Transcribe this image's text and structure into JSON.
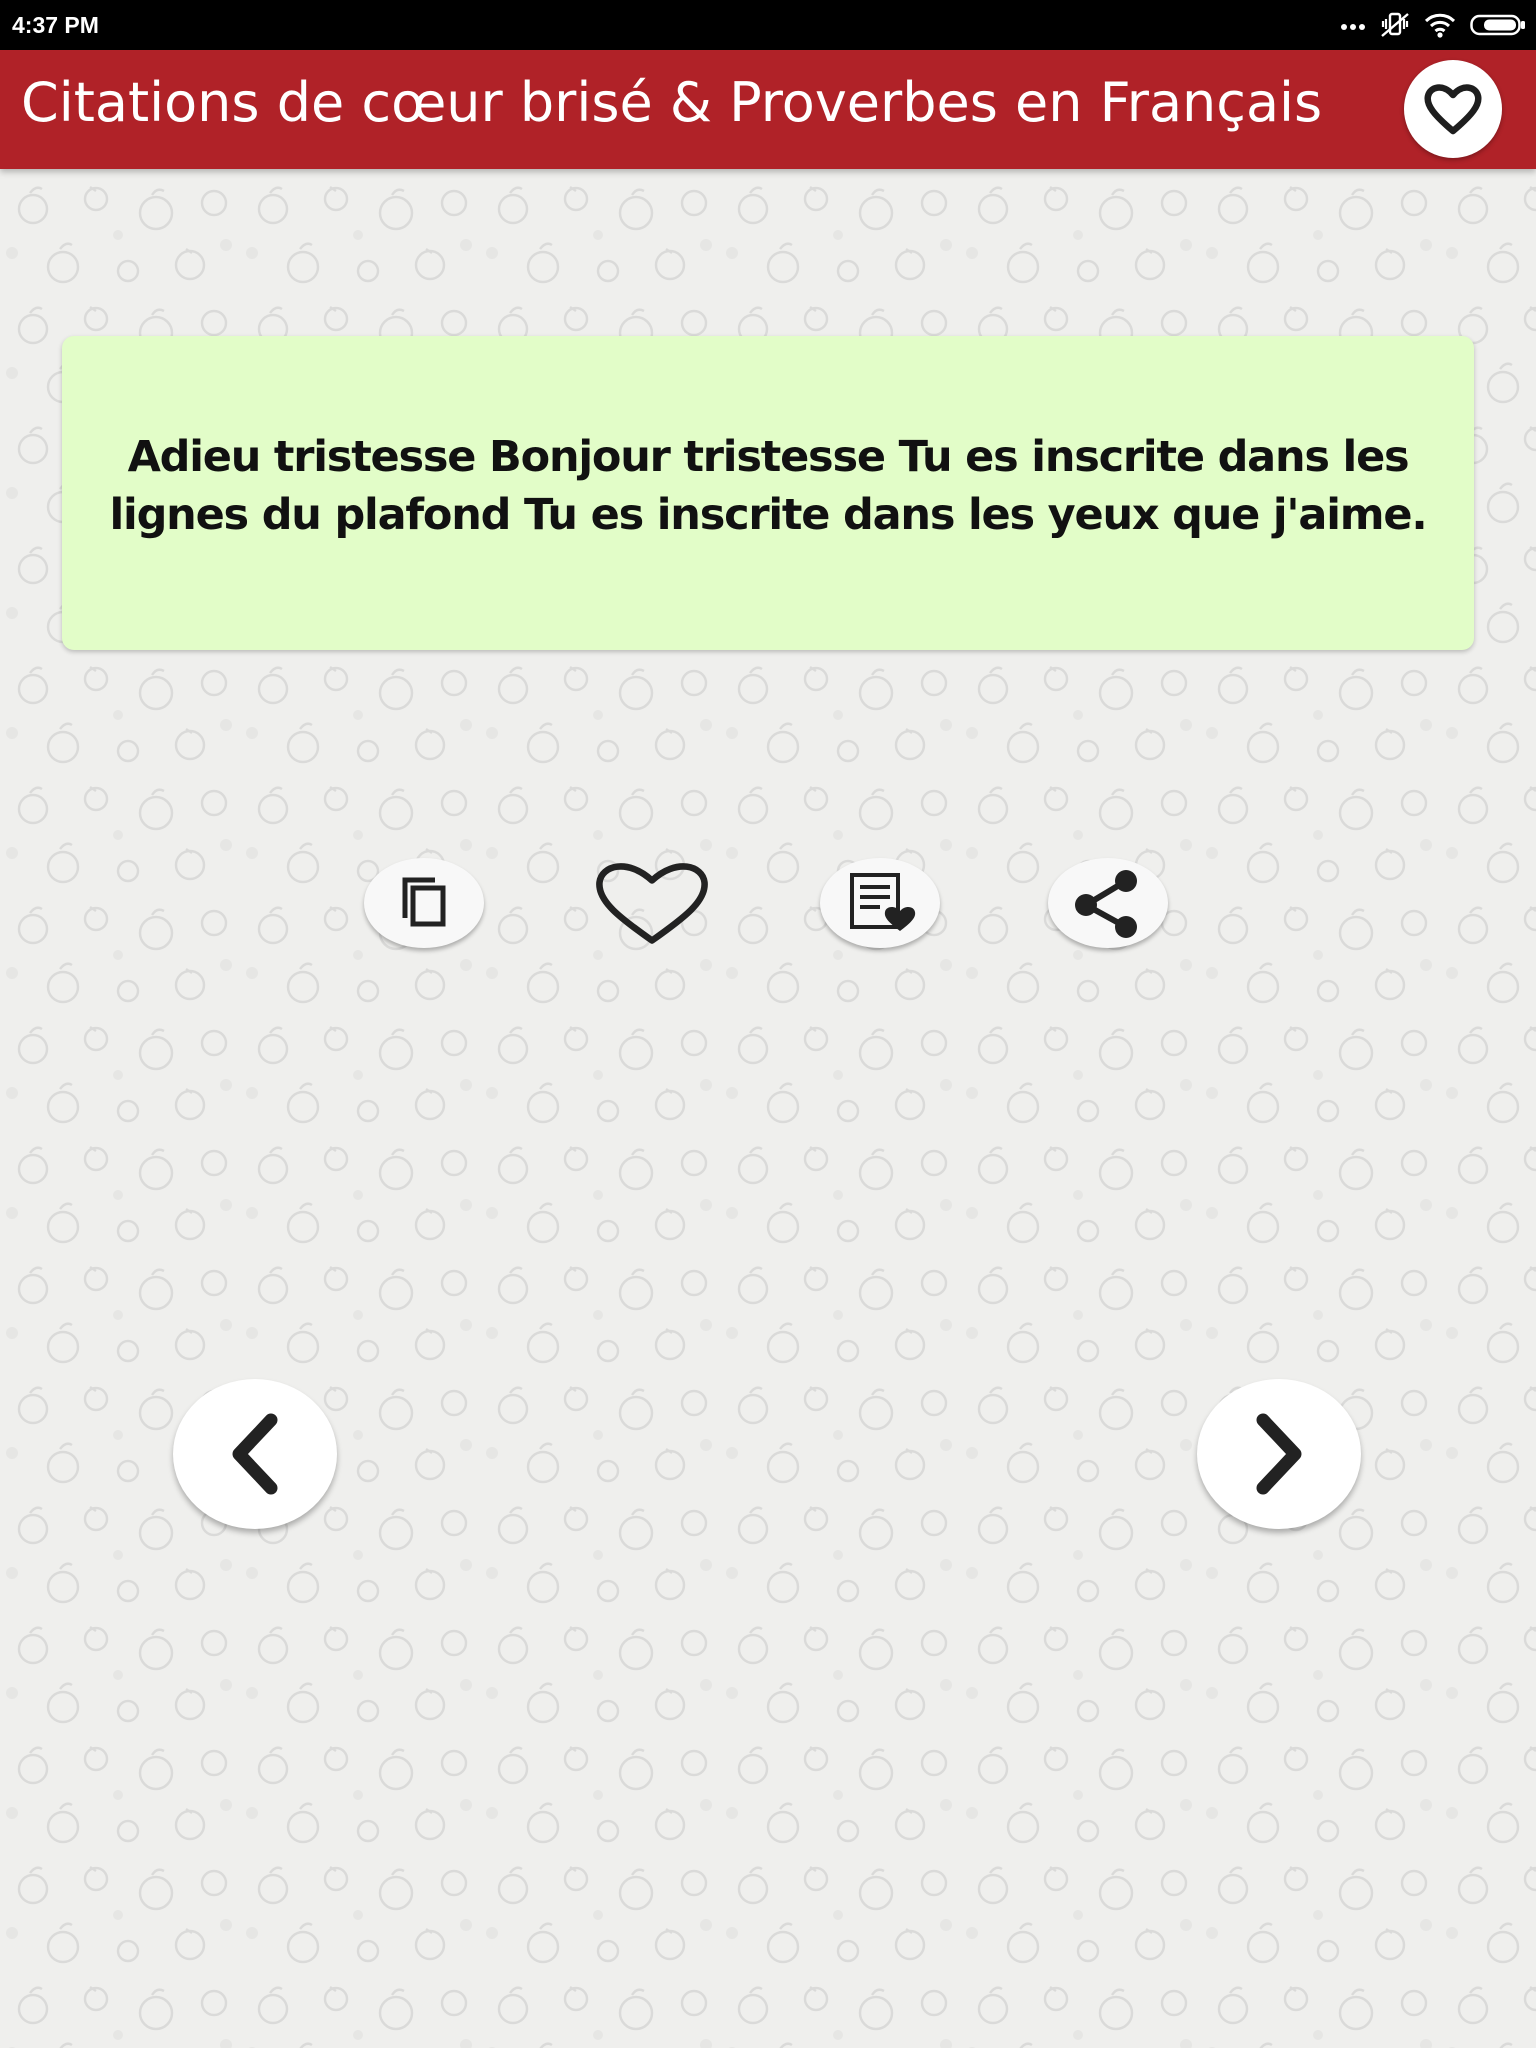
{
  "status_bar": {
    "time": "4:37 PM",
    "icons": [
      "more-dots-icon",
      "vibrate-icon",
      "wifi-icon",
      "battery-icon"
    ]
  },
  "app_bar": {
    "title": "Citations de cœur brisé & Proverbes en Français",
    "favorites_icon": "heart-outline-icon"
  },
  "quote": {
    "text": "Adieu tristesse Bonjour tristesse Tu es inscrite dans les lignes du plafond Tu es inscrite dans les yeux que j'aime."
  },
  "actions": [
    {
      "icon": "copy-icon"
    },
    {
      "icon": "heart-outline-icon"
    },
    {
      "icon": "note-heart-icon"
    },
    {
      "icon": "share-icon"
    }
  ],
  "navigation": {
    "previous_icon": "chevron-left-icon",
    "next_icon": "chevron-right-icon"
  },
  "colors": {
    "app_bar": "#b02228",
    "status_bar": "#000000",
    "card": "#e2fdc8",
    "background": "#efefed",
    "icon": "#222222"
  }
}
